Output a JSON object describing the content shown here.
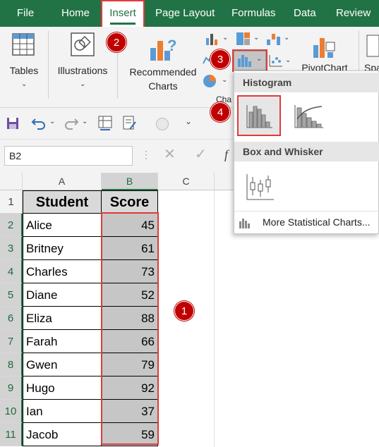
{
  "menubar": {
    "items": [
      "File",
      "Home",
      "Insert",
      "Page Layout",
      "Formulas",
      "Data",
      "Review"
    ],
    "active": "Insert"
  },
  "ribbon": {
    "tables": "Tables",
    "illustrations": "Illustrations",
    "recommended_line1": "Recommended",
    "recommended_line2": "Charts",
    "pivotchart": "PivotChart",
    "charts_group": "Cha",
    "sparklines": "Spa"
  },
  "namebox": "B2",
  "formula_fx": "f",
  "grid": {
    "columns": [
      "A",
      "B",
      "C"
    ],
    "header": {
      "student": "Student",
      "score": "Score"
    },
    "rows": [
      {
        "num": "1"
      },
      {
        "num": "2",
        "name": "Alice",
        "score": "45"
      },
      {
        "num": "3",
        "name": "Britney",
        "score": "61"
      },
      {
        "num": "4",
        "name": "Charles",
        "score": "73"
      },
      {
        "num": "5",
        "name": "Diane",
        "score": "52"
      },
      {
        "num": "6",
        "name": "Eliza",
        "score": "88"
      },
      {
        "num": "7",
        "name": "Farah",
        "score": "66"
      },
      {
        "num": "8",
        "name": "Gwen",
        "score": "79"
      },
      {
        "num": "9",
        "name": "Hugo",
        "score": "92"
      },
      {
        "num": "10",
        "name": "Ian",
        "score": "37"
      },
      {
        "num": "11",
        "name": "Jacob",
        "score": "59"
      }
    ]
  },
  "dropdown": {
    "histogram": "Histogram",
    "box_whisker": "Box and Whisker",
    "more": "More Statistical Charts..."
  },
  "badges": {
    "one": "1",
    "two": "2",
    "three": "3",
    "four": "4"
  },
  "colors": {
    "excel_green": "#217346",
    "badge_red": "#c00000",
    "selection_gray": "#c6c6c6"
  }
}
